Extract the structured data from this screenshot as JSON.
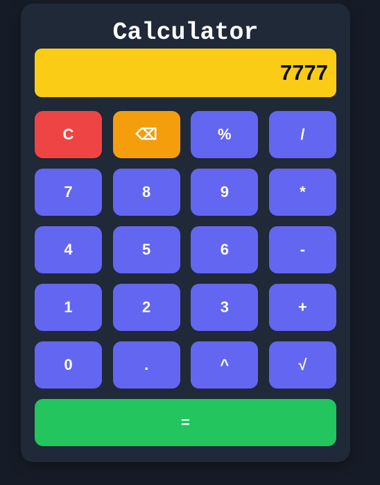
{
  "app": {
    "title": "Calculator"
  },
  "display": {
    "value": "7777"
  },
  "keys": {
    "clear": "C",
    "backspace": "⌫",
    "percent": "%",
    "divide": "/",
    "seven": "7",
    "eight": "8",
    "nine": "9",
    "multiply": "*",
    "four": "4",
    "five": "5",
    "six": "6",
    "subtract": "-",
    "one": "1",
    "two": "2",
    "three": "3",
    "add": "+",
    "zero": "0",
    "decimal": ".",
    "power": "^",
    "sqrt": "√",
    "equals": "="
  },
  "colors": {
    "background": "#161c27",
    "panel": "#1f2937",
    "display": "#facc15",
    "key": "#6366f1",
    "clear": "#ef4444",
    "backspace": "#f59e0b",
    "equals": "#22c55e"
  }
}
